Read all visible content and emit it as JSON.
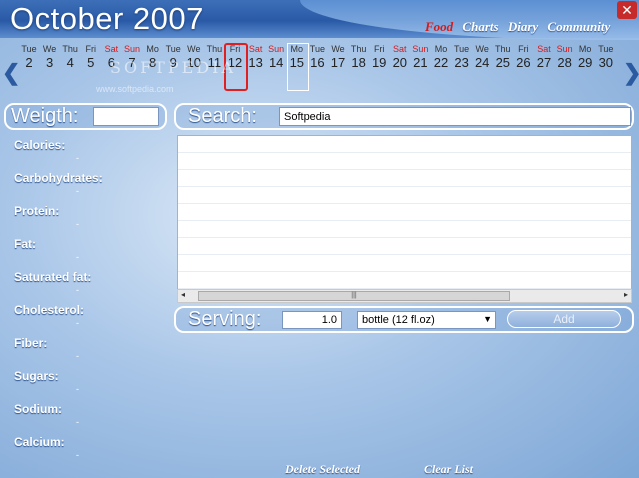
{
  "header": {
    "title": "October 2007",
    "nav": [
      {
        "label": "Food",
        "active": true
      },
      {
        "label": "Charts",
        "active": false
      },
      {
        "label": "Diary",
        "active": false
      },
      {
        "label": "Community",
        "active": false
      }
    ],
    "close_glyph": "✕"
  },
  "calendar": {
    "prev_glyph": "❮",
    "next_glyph": "❯",
    "days": [
      {
        "dn": "Tue",
        "dd": "2",
        "we": false
      },
      {
        "dn": "We",
        "dd": "3",
        "we": false
      },
      {
        "dn": "Thu",
        "dd": "4",
        "we": false
      },
      {
        "dn": "Fri",
        "dd": "5",
        "we": false
      },
      {
        "dn": "Sat",
        "dd": "6",
        "we": true
      },
      {
        "dn": "Sun",
        "dd": "7",
        "we": true
      },
      {
        "dn": "Mo",
        "dd": "8",
        "we": false
      },
      {
        "dn": "Tue",
        "dd": "9",
        "we": false
      },
      {
        "dn": "We",
        "dd": "10",
        "we": false
      },
      {
        "dn": "Thu",
        "dd": "11",
        "we": false
      },
      {
        "dn": "Fri",
        "dd": "12",
        "we": false
      },
      {
        "dn": "Sat",
        "dd": "13",
        "we": true
      },
      {
        "dn": "Sun",
        "dd": "14",
        "we": true
      },
      {
        "dn": "Mo",
        "dd": "15",
        "we": false
      },
      {
        "dn": "Tue",
        "dd": "16",
        "we": false
      },
      {
        "dn": "We",
        "dd": "17",
        "we": false
      },
      {
        "dn": "Thu",
        "dd": "18",
        "we": false
      },
      {
        "dn": "Fri",
        "dd": "19",
        "we": false
      },
      {
        "dn": "Sat",
        "dd": "20",
        "we": true
      },
      {
        "dn": "Sun",
        "dd": "21",
        "we": true
      },
      {
        "dn": "Mo",
        "dd": "22",
        "we": false
      },
      {
        "dn": "Tue",
        "dd": "23",
        "we": false
      },
      {
        "dn": "We",
        "dd": "24",
        "we": false
      },
      {
        "dn": "Thu",
        "dd": "25",
        "we": false
      },
      {
        "dn": "Fri",
        "dd": "26",
        "we": false
      },
      {
        "dn": "Sat",
        "dd": "27",
        "we": true
      },
      {
        "dn": "Sun",
        "dd": "28",
        "we": true
      },
      {
        "dn": "Mo",
        "dd": "29",
        "we": false
      },
      {
        "dn": "Tue",
        "dd": "30",
        "we": false
      }
    ],
    "today": "12",
    "selected": "15"
  },
  "watermark": {
    "text": "SOFTPEDIA",
    "url": "www.softpedia.com"
  },
  "weight": {
    "label": "Weigth:",
    "value": ""
  },
  "search": {
    "label": "Search:",
    "value": "Softpedia"
  },
  "nutrients": [
    {
      "label": "Calories:",
      "value": "-"
    },
    {
      "label": "Carbohydrates:",
      "value": "-"
    },
    {
      "label": "Protein:",
      "value": "-"
    },
    {
      "label": "Fat:",
      "value": "-"
    },
    {
      "label": "Saturated fat:",
      "value": "-"
    },
    {
      "label": "Cholesterol:",
      "value": "-"
    },
    {
      "label": "Fiber:",
      "value": "-"
    },
    {
      "label": "Sugars:",
      "value": "-"
    },
    {
      "label": "Sodium:",
      "value": "-"
    },
    {
      "label": "Calcium:",
      "value": "-"
    }
  ],
  "scroll": {
    "left_glyph": "◂",
    "right_glyph": "▸",
    "thumb_glyph": "|||"
  },
  "serving": {
    "label": "Serving:",
    "amount": "1.0",
    "unit": "bottle (12 fl.oz)",
    "add_label": "Add"
  },
  "footer": {
    "delete_label": "Delete Selected",
    "clear_label": "Clear List"
  }
}
